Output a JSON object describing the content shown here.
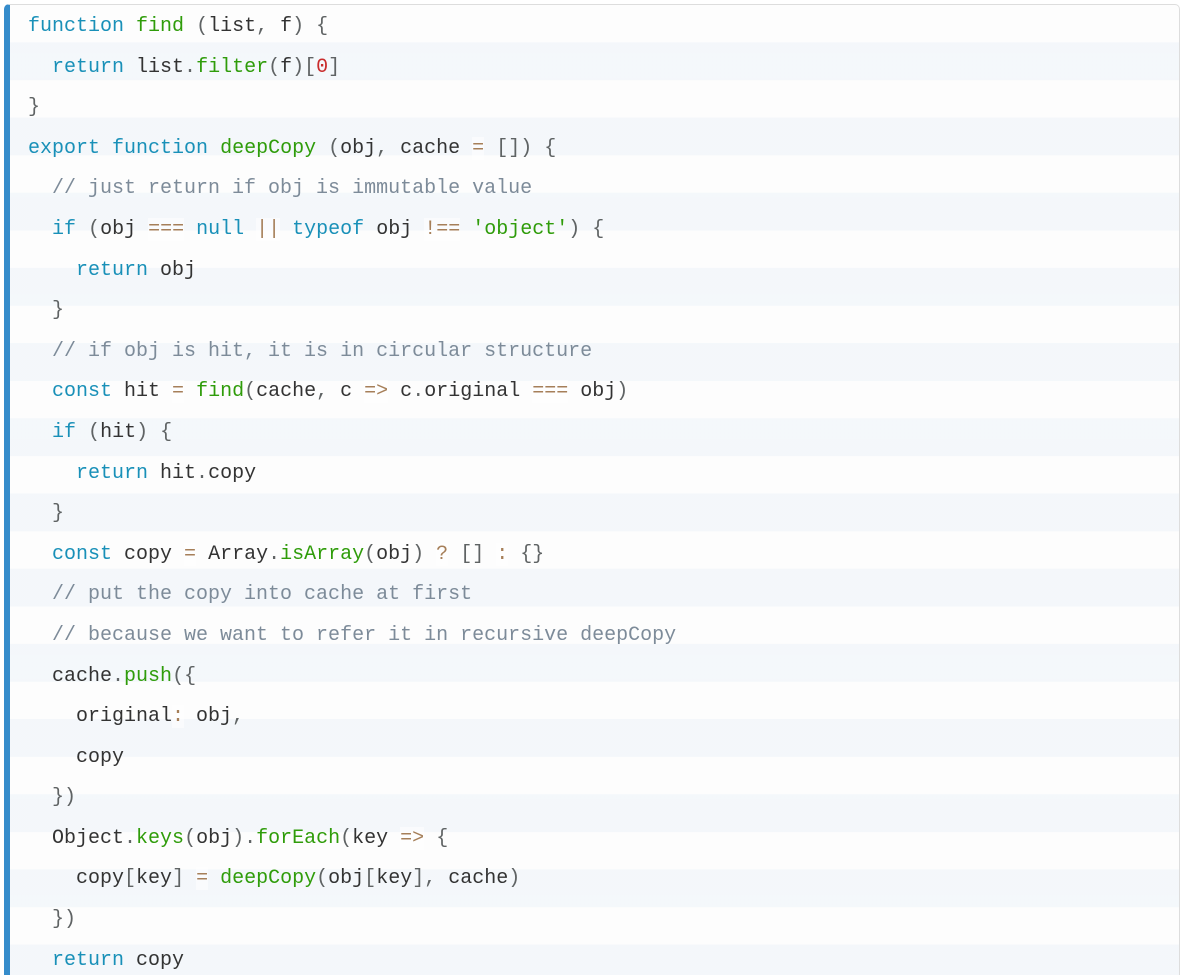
{
  "code": {
    "lines": [
      {
        "indent": 0,
        "tokens": [
          {
            "t": "function",
            "c": "kw"
          },
          {
            "t": " "
          },
          {
            "t": "find",
            "c": "fn"
          },
          {
            "t": " "
          },
          {
            "t": "(",
            "c": "pn"
          },
          {
            "t": "list"
          },
          {
            "t": ",",
            "c": "pn"
          },
          {
            "t": " f"
          },
          {
            "t": ")",
            "c": "pn"
          },
          {
            "t": " "
          },
          {
            "t": "{",
            "c": "pn"
          }
        ]
      },
      {
        "indent": 1,
        "tokens": [
          {
            "t": "return",
            "c": "kw"
          },
          {
            "t": " list"
          },
          {
            "t": ".",
            "c": "pn"
          },
          {
            "t": "filter",
            "c": "fn"
          },
          {
            "t": "(",
            "c": "pn"
          },
          {
            "t": "f"
          },
          {
            "t": ")",
            "c": "pn"
          },
          {
            "t": "[",
            "c": "pn"
          },
          {
            "t": "0",
            "c": "num"
          },
          {
            "t": "]",
            "c": "pn"
          }
        ]
      },
      {
        "indent": 0,
        "tokens": [
          {
            "t": "}",
            "c": "pn"
          }
        ]
      },
      {
        "indent": 0,
        "tokens": [
          {
            "t": "export",
            "c": "kw"
          },
          {
            "t": " "
          },
          {
            "t": "function",
            "c": "kw"
          },
          {
            "t": " "
          },
          {
            "t": "deepCopy",
            "c": "fn"
          },
          {
            "t": " "
          },
          {
            "t": "(",
            "c": "pn"
          },
          {
            "t": "obj"
          },
          {
            "t": ",",
            "c": "pn"
          },
          {
            "t": " cache "
          },
          {
            "t": "=",
            "c": "op"
          },
          {
            "t": " "
          },
          {
            "t": "[",
            "c": "pn"
          },
          {
            "t": "]",
            "c": "pn"
          },
          {
            "t": ")",
            "c": "pn"
          },
          {
            "t": " "
          },
          {
            "t": "{",
            "c": "pn"
          }
        ]
      },
      {
        "indent": 1,
        "tokens": [
          {
            "t": "// just return if obj is immutable value",
            "c": "cmt"
          }
        ]
      },
      {
        "indent": 1,
        "tokens": [
          {
            "t": "if",
            "c": "kw"
          },
          {
            "t": " "
          },
          {
            "t": "(",
            "c": "pn"
          },
          {
            "t": "obj "
          },
          {
            "t": "===",
            "c": "op"
          },
          {
            "t": " "
          },
          {
            "t": "null",
            "c": "kw"
          },
          {
            "t": " "
          },
          {
            "t": "||",
            "c": "op"
          },
          {
            "t": " "
          },
          {
            "t": "typeof",
            "c": "kw"
          },
          {
            "t": " obj "
          },
          {
            "t": "!==",
            "c": "op"
          },
          {
            "t": " "
          },
          {
            "t": "'object'",
            "c": "str"
          },
          {
            "t": ")",
            "c": "pn"
          },
          {
            "t": " "
          },
          {
            "t": "{",
            "c": "pn"
          }
        ]
      },
      {
        "indent": 2,
        "tokens": [
          {
            "t": "return",
            "c": "kw"
          },
          {
            "t": " obj"
          }
        ]
      },
      {
        "indent": 1,
        "tokens": [
          {
            "t": "}",
            "c": "pn"
          }
        ]
      },
      {
        "indent": 1,
        "tokens": [
          {
            "t": "// if obj is hit, it is in circular structure",
            "c": "cmt"
          }
        ]
      },
      {
        "indent": 1,
        "tokens": [
          {
            "t": "const",
            "c": "kw"
          },
          {
            "t": " hit "
          },
          {
            "t": "=",
            "c": "op"
          },
          {
            "t": " "
          },
          {
            "t": "find",
            "c": "fn"
          },
          {
            "t": "(",
            "c": "pn"
          },
          {
            "t": "cache"
          },
          {
            "t": ",",
            "c": "pn"
          },
          {
            "t": " c "
          },
          {
            "t": "=>",
            "c": "op"
          },
          {
            "t": " c"
          },
          {
            "t": ".",
            "c": "pn"
          },
          {
            "t": "original "
          },
          {
            "t": "===",
            "c": "op"
          },
          {
            "t": " obj"
          },
          {
            "t": ")",
            "c": "pn"
          }
        ]
      },
      {
        "indent": 1,
        "tokens": [
          {
            "t": "if",
            "c": "kw"
          },
          {
            "t": " "
          },
          {
            "t": "(",
            "c": "pn"
          },
          {
            "t": "hit"
          },
          {
            "t": ")",
            "c": "pn"
          },
          {
            "t": " "
          },
          {
            "t": "{",
            "c": "pn"
          }
        ]
      },
      {
        "indent": 2,
        "tokens": [
          {
            "t": "return",
            "c": "kw"
          },
          {
            "t": " hit"
          },
          {
            "t": ".",
            "c": "pn"
          },
          {
            "t": "copy"
          }
        ]
      },
      {
        "indent": 1,
        "tokens": [
          {
            "t": "}",
            "c": "pn"
          }
        ]
      },
      {
        "indent": 1,
        "tokens": [
          {
            "t": "const",
            "c": "kw"
          },
          {
            "t": " copy "
          },
          {
            "t": "=",
            "c": "op"
          },
          {
            "t": " Array"
          },
          {
            "t": ".",
            "c": "pn"
          },
          {
            "t": "isArray",
            "c": "fn"
          },
          {
            "t": "(",
            "c": "pn"
          },
          {
            "t": "obj"
          },
          {
            "t": ")",
            "c": "pn"
          },
          {
            "t": " "
          },
          {
            "t": "?",
            "c": "op"
          },
          {
            "t": " "
          },
          {
            "t": "[",
            "c": "pn"
          },
          {
            "t": "]",
            "c": "pn"
          },
          {
            "t": " "
          },
          {
            "t": ":",
            "c": "op"
          },
          {
            "t": " "
          },
          {
            "t": "{",
            "c": "pn"
          },
          {
            "t": "}",
            "c": "pn"
          }
        ]
      },
      {
        "indent": 1,
        "tokens": [
          {
            "t": "// put the copy into cache at first",
            "c": "cmt"
          }
        ]
      },
      {
        "indent": 1,
        "tokens": [
          {
            "t": "// because we want to refer it in recursive deepCopy",
            "c": "cmt"
          }
        ]
      },
      {
        "indent": 1,
        "tokens": [
          {
            "t": "cache"
          },
          {
            "t": ".",
            "c": "pn"
          },
          {
            "t": "push",
            "c": "fn"
          },
          {
            "t": "(",
            "c": "pn"
          },
          {
            "t": "{",
            "c": "pn"
          }
        ]
      },
      {
        "indent": 2,
        "tokens": [
          {
            "t": "original"
          },
          {
            "t": ":",
            "c": "op"
          },
          {
            "t": " obj"
          },
          {
            "t": ",",
            "c": "pn"
          }
        ]
      },
      {
        "indent": 2,
        "tokens": [
          {
            "t": "copy"
          }
        ]
      },
      {
        "indent": 1,
        "tokens": [
          {
            "t": "}",
            "c": "pn"
          },
          {
            "t": ")",
            "c": "pn"
          }
        ]
      },
      {
        "indent": 1,
        "tokens": [
          {
            "t": "Object"
          },
          {
            "t": ".",
            "c": "pn"
          },
          {
            "t": "keys",
            "c": "fn"
          },
          {
            "t": "(",
            "c": "pn"
          },
          {
            "t": "obj"
          },
          {
            "t": ")",
            "c": "pn"
          },
          {
            "t": ".",
            "c": "pn"
          },
          {
            "t": "forEach",
            "c": "fn"
          },
          {
            "t": "(",
            "c": "pn"
          },
          {
            "t": "key "
          },
          {
            "t": "=>",
            "c": "op"
          },
          {
            "t": " "
          },
          {
            "t": "{",
            "c": "pn"
          }
        ]
      },
      {
        "indent": 2,
        "tokens": [
          {
            "t": "copy"
          },
          {
            "t": "[",
            "c": "pn"
          },
          {
            "t": "key"
          },
          {
            "t": "]",
            "c": "pn"
          },
          {
            "t": " "
          },
          {
            "t": "=",
            "c": "op"
          },
          {
            "t": " "
          },
          {
            "t": "deepCopy",
            "c": "fn"
          },
          {
            "t": "(",
            "c": "pn"
          },
          {
            "t": "obj"
          },
          {
            "t": "[",
            "c": "pn"
          },
          {
            "t": "key"
          },
          {
            "t": "]",
            "c": "pn"
          },
          {
            "t": ",",
            "c": "pn"
          },
          {
            "t": " cache"
          },
          {
            "t": ")",
            "c": "pn"
          }
        ]
      },
      {
        "indent": 1,
        "tokens": [
          {
            "t": "}",
            "c": "pn"
          },
          {
            "t": ")",
            "c": "pn"
          }
        ]
      },
      {
        "indent": 1,
        "tokens": [
          {
            "t": "return",
            "c": "kw"
          },
          {
            "t": " copy"
          }
        ]
      },
      {
        "indent": 0,
        "tokens": [
          {
            "t": "}",
            "c": "pn"
          }
        ]
      }
    ]
  }
}
